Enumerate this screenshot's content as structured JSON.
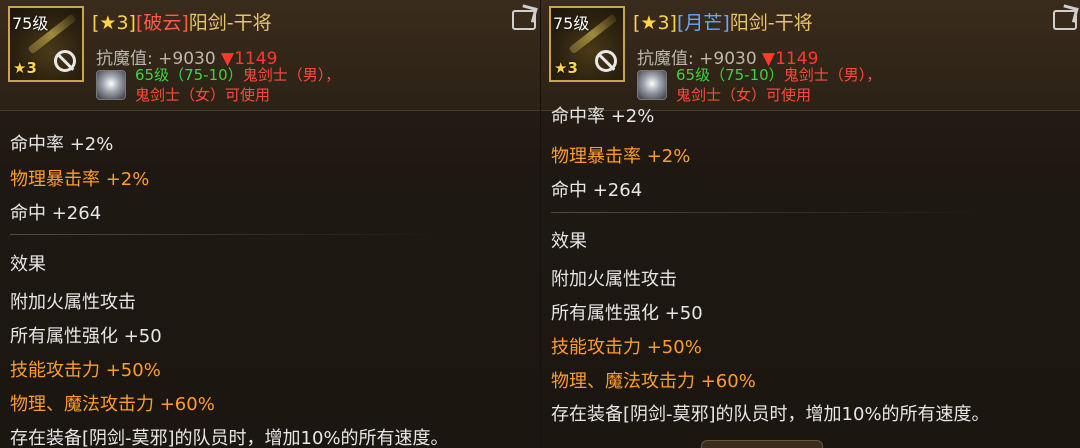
{
  "left": {
    "level": "75级",
    "star_badge": "★3",
    "title_prefix": "[★3]",
    "title_tag": "[破云]",
    "title_name": "阳剑-干将",
    "anti_label": "抗魔值: +9030",
    "anti_change": "▼1149",
    "req_level": "65级（75-10）",
    "req_class1": "鬼剑士（男），",
    "req_class2": "鬼剑士（女）可使用",
    "stats": [
      {
        "text": "命中率 +2%",
        "color": "white"
      },
      {
        "text": "物理暴击率 +2%",
        "color": "orange"
      },
      {
        "text": "命中 +264",
        "color": "white"
      }
    ],
    "effect_title": "效果",
    "effects": [
      {
        "text": "附加火属性攻击",
        "color": "white"
      },
      {
        "text": "所有属性强化 +50",
        "color": "white"
      },
      {
        "text": "技能攻击力 +50%",
        "color": "orange"
      },
      {
        "text": "物理、魔法攻击力 +60%",
        "color": "orange"
      },
      {
        "text": "存在装备[阴剑-莫邪]的队员时，增加10%的所有速度。",
        "color": "white"
      }
    ]
  },
  "right": {
    "level": "75级",
    "star_badge": "★3",
    "title_prefix": "[★3]",
    "title_tag": "[月芒]",
    "title_name": "阳剑-干将",
    "anti_label": "抗魔值: +9030",
    "anti_change": "▼1149",
    "req_level": "65级（75-10）",
    "req_class1": "鬼剑士（男），",
    "req_class2": "鬼剑士（女）可使用",
    "stats": [
      {
        "text": "命中率 +2%",
        "color": "white"
      },
      {
        "text": "物理暴击率 +2%",
        "color": "orange"
      },
      {
        "text": "命中 +264",
        "color": "white"
      }
    ],
    "effect_title": "效果",
    "effects": [
      {
        "text": "附加火属性攻击",
        "color": "white"
      },
      {
        "text": "所有属性强化 +50",
        "color": "white"
      },
      {
        "text": "技能攻击力 +50%",
        "color": "orange"
      },
      {
        "text": "物理、魔法攻击力 +60%",
        "color": "orange"
      },
      {
        "text": "存在装备[阴剑-莫邪]的队员时，增加10%的所有速度。",
        "color": "white"
      }
    ]
  },
  "colors": {
    "orange": "#ff9d2a",
    "green": "#3fd33f",
    "red": "#ff4b3b",
    "gold": "#e8c368",
    "tag_red": "#ff5a4a",
    "tag_blue": "#66a8ff"
  }
}
